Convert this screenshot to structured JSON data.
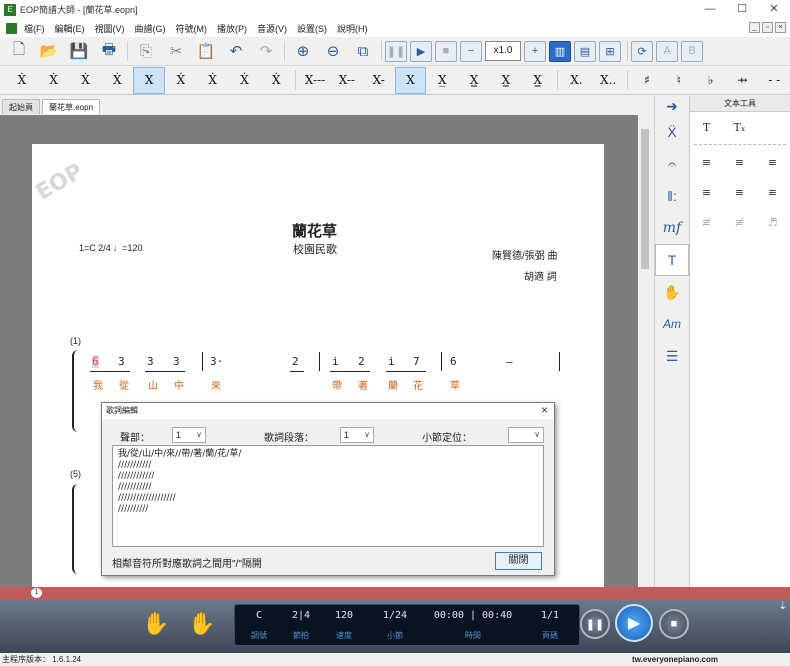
{
  "window": {
    "title": "EOP簡譜大師 - [蘭花草.eopn]",
    "minimize": "—",
    "maximize": "☐",
    "close": "✕"
  },
  "menu": [
    "檔(F)",
    "編輯(E)",
    "視圖(V)",
    "曲譜(G)",
    "符號(M)",
    "播放(P)",
    "音源(V)",
    "設置(S)",
    "說明(H)"
  ],
  "toolbar": {
    "tempo_value": "x1.0"
  },
  "tabs": [
    "起始頁",
    "蘭花草.eopn"
  ],
  "score": {
    "title": "蘭花草",
    "subtitle": "校園民歌",
    "key_signature": "1=C 2/4 ♩=120",
    "composer": "陳賢德/張弼 曲",
    "lyricist": "胡適 詞",
    "measure_1": "(1)",
    "measure_5": "(5)",
    "lyrics_line": [
      "我",
      "從",
      "山",
      "中",
      "來",
      "帶",
      "著",
      "蘭",
      "花",
      "草"
    ]
  },
  "text_panel": {
    "title": "文本工具"
  },
  "dialog": {
    "title": "歌詞編輯",
    "part_label": "聲部：",
    "part_value": "1",
    "verse_label": "歌詞段落：",
    "verse_value": "1",
    "measure_label": "小節定位：",
    "measure_value": "",
    "lyrics_text": "我/從/山/中/來//帶/著/蘭/花/草/\n///////////\n////////////\n///////////\n///////////////////\n//////////",
    "hint": "相鄰音符所對應歌詞之間用\"/\"隔開",
    "close_button": "關閉"
  },
  "transport": {
    "values": [
      "C",
      "2|4",
      "120",
      "1/24",
      "00:00 | 00:40",
      "1/1"
    ],
    "labels": [
      "調號",
      "節拍",
      "速度",
      "小節",
      "時間",
      "頁碼"
    ]
  },
  "ruler": {
    "marker": "1"
  },
  "status": {
    "version": "主程序版本： 1.6.1.24",
    "website": "tw.everyonepiano.com"
  }
}
